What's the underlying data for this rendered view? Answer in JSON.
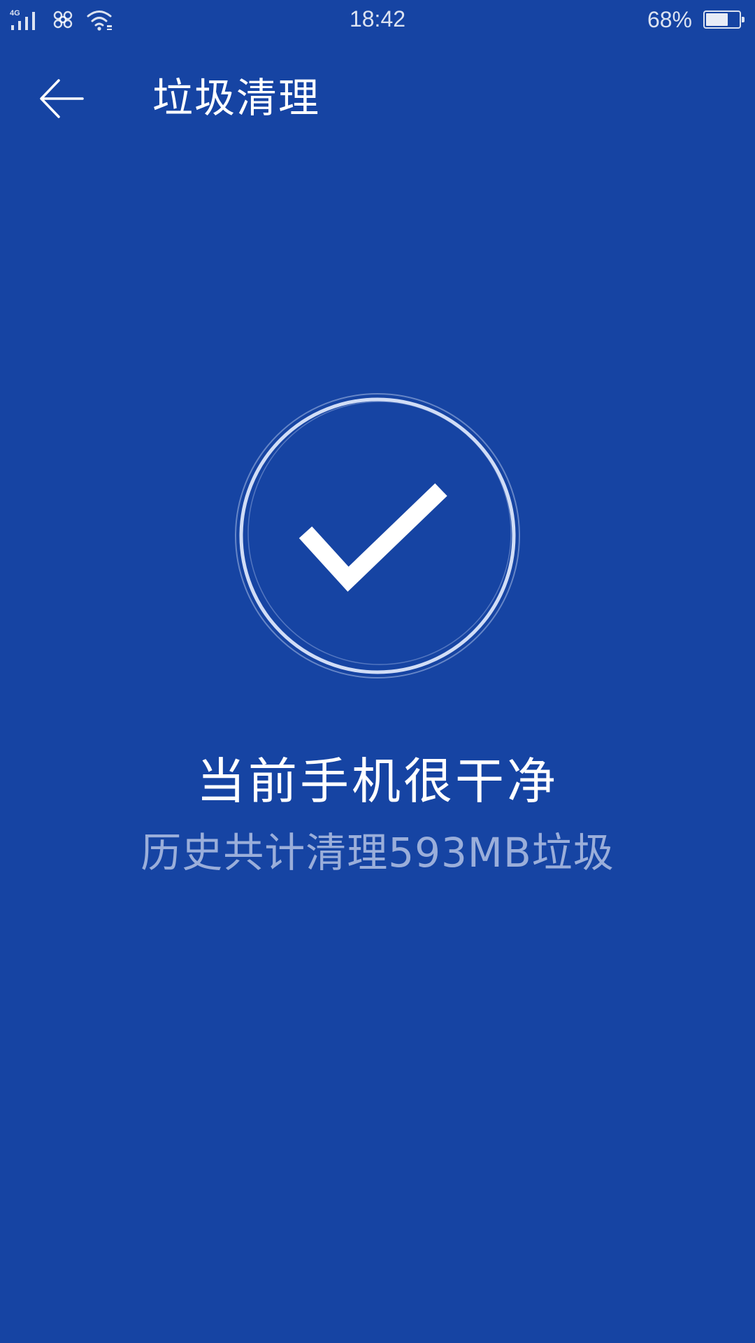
{
  "status_bar": {
    "network_type": "4G",
    "time": "18:42",
    "battery_percent": "68%",
    "battery_level": 0.68,
    "icons": [
      "signal-icon",
      "carrier-logo-icon",
      "wifi-icon",
      "battery-icon"
    ]
  },
  "app_bar": {
    "back_icon": "arrow-left-icon",
    "title": "垃圾清理"
  },
  "main": {
    "status_icon": "checkmark-icon",
    "headline": "当前手机很干净",
    "subline": "历史共计清理593MB垃圾"
  },
  "colors": {
    "background": "#1644a3",
    "primary_text": "#ffffff",
    "secondary_text": "#a9b8e0"
  }
}
